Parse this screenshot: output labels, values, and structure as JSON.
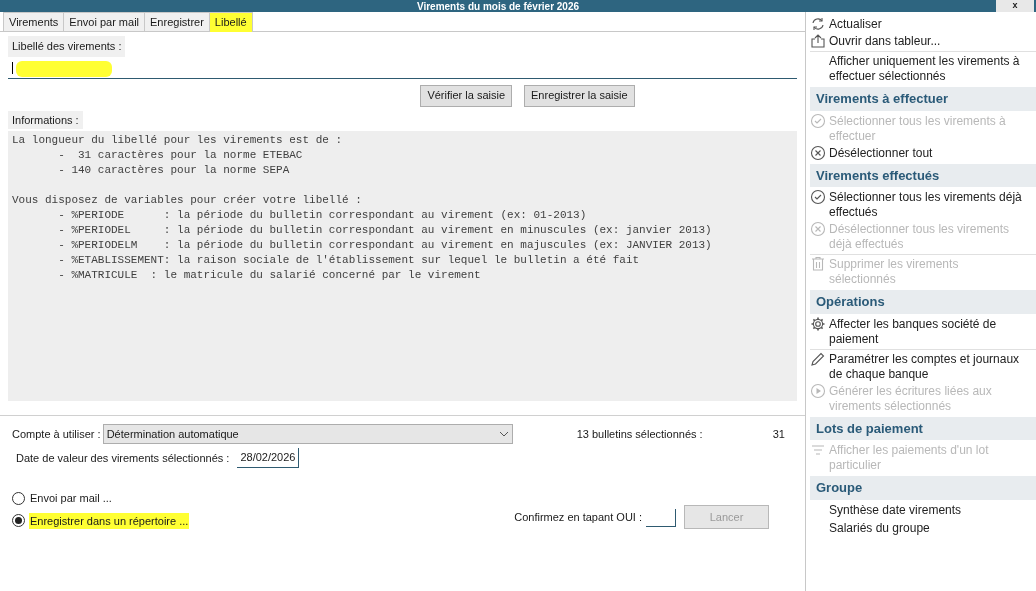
{
  "window": {
    "title": "Virements du mois de février 2026",
    "close": "x"
  },
  "tabs": [
    {
      "label": "Virements",
      "selected": false,
      "highlighted": false
    },
    {
      "label": "Envoi par mail",
      "selected": false,
      "highlighted": false
    },
    {
      "label": "Enregistrer",
      "selected": false,
      "highlighted": false
    },
    {
      "label": "Libellé",
      "selected": true,
      "highlighted": true
    }
  ],
  "libelle": {
    "label": "Libellé des virements :",
    "highlighted": true
  },
  "buttons": [
    {
      "label": "Vérifier la saisie"
    },
    {
      "label": "Enregistrer la saisie"
    }
  ],
  "informations": {
    "label": "Informations :",
    "paragraphs": [
      [
        "La longueur du libellé pour les virements est de :",
        "       -  31 caractères pour la norme ETEBAC",
        "       - 140 caractères pour la norme SEPA"
      ],
      [
        "Vous disposez de variables pour créer votre libellé :",
        "       - %PERIODE      : la période du bulletin correspondant au virement (ex: 01-2013)",
        "       - %PERIODEL     : la période du bulletin correspondant au virement en minuscules (ex: janvier 2013)",
        "       - %PERIODELM    : la période du bulletin correspondant au virement en majuscules (ex: JANVIER 2013)",
        "       - %ETABLISSEMENT: la raison sociale de l'établissement sur lequel le bulletin a été fait",
        "       - %MATRICULE  : le matricule du salarié concerné par le virement"
      ]
    ]
  },
  "compte": {
    "label": "Compte à utiliser :",
    "value": "Détermination automatique"
  },
  "selection": {
    "label": "13 bulletins sélectionnés :",
    "value": "31"
  },
  "date": {
    "label": "Date de valeur des virements sélectionnés :",
    "value": "28/02/2026"
  },
  "options": [
    {
      "label": "Envoi par mail ...",
      "selected": false,
      "highlighted": false
    },
    {
      "label": "Enregistrer dans un répertoire ...",
      "selected": true,
      "highlighted": true
    }
  ],
  "confirm": {
    "label": "Confirmez en tapant OUI :",
    "button": "Lancer",
    "button_disabled": true
  },
  "sidebar": {
    "items": [
      {
        "kind": "action",
        "label": "Actualiser",
        "disabled": false
      },
      {
        "kind": "action",
        "label": "Ouvrir dans tableur...",
        "disabled": false
      },
      {
        "kind": "separator"
      },
      {
        "kind": "action",
        "label": "Afficher uniquement les virements à effectuer sélectionnés",
        "disabled": false
      },
      {
        "kind": "header",
        "label": "Virements à effectuer"
      },
      {
        "kind": "action",
        "label": "Sélectionner tous les virements à effectuer",
        "disabled": true
      },
      {
        "kind": "action",
        "label": "Désélectionner tout",
        "disabled": false
      },
      {
        "kind": "header",
        "label": "Virements effectués"
      },
      {
        "kind": "action",
        "label": "Sélectionner tous les virements déjà effectués",
        "disabled": false
      },
      {
        "kind": "action",
        "label": "Désélectionner tous les virements déjà effectués",
        "disabled": true
      },
      {
        "kind": "separator"
      },
      {
        "kind": "action",
        "label": "Supprimer les virements sélectionnés",
        "disabled": true
      },
      {
        "kind": "header",
        "label": "Opérations"
      },
      {
        "kind": "action",
        "label": "Affecter les banques société de paiement",
        "disabled": false
      },
      {
        "kind": "separator"
      },
      {
        "kind": "action",
        "label": "Paramétrer les comptes et journaux de chaque banque",
        "disabled": false
      },
      {
        "kind": "action",
        "label": "Générer les écritures liées aux virements sélectionnés",
        "disabled": true
      },
      {
        "kind": "header",
        "label": "Lots de paiement"
      },
      {
        "kind": "action",
        "label": "Afficher les paiements d'un lot particulier",
        "disabled": true
      },
      {
        "kind": "header",
        "label": "Groupe"
      },
      {
        "kind": "action",
        "label": "Synthèse date virements",
        "disabled": false
      },
      {
        "kind": "action",
        "label": "Salariés du groupe",
        "disabled": false
      }
    ]
  }
}
